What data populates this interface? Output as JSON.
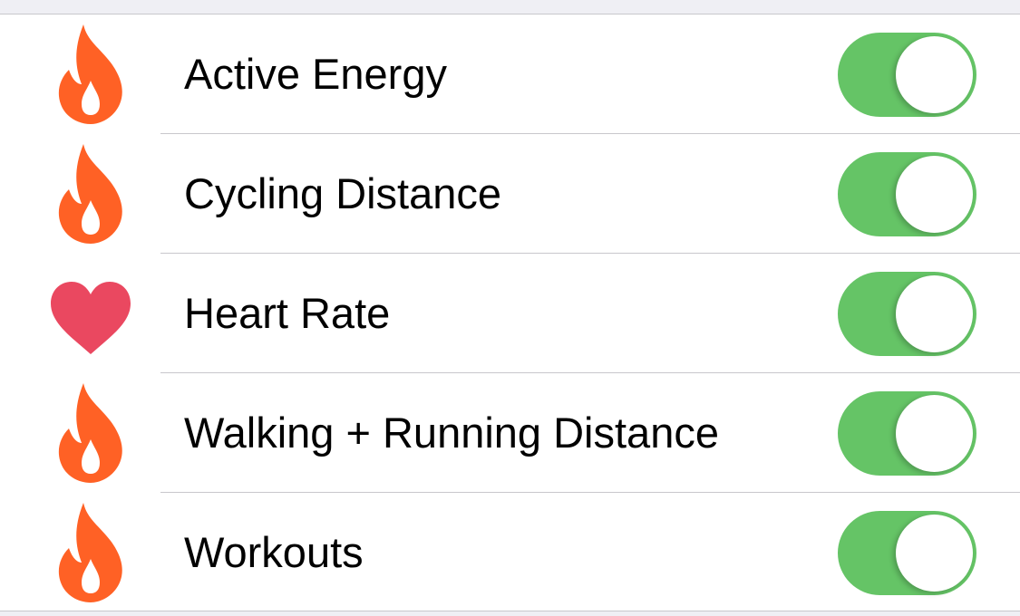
{
  "colors": {
    "flame": "#ff6125",
    "heart": "#ea4860",
    "toggle_on": "#65c466"
  },
  "items": [
    {
      "label": "Active Energy",
      "icon": "flame-icon",
      "on": true
    },
    {
      "label": "Cycling Distance",
      "icon": "flame-icon",
      "on": true
    },
    {
      "label": "Heart Rate",
      "icon": "heart-icon",
      "on": true
    },
    {
      "label": "Walking + Running Distance",
      "icon": "flame-icon",
      "on": true
    },
    {
      "label": "Workouts",
      "icon": "flame-icon",
      "on": true
    }
  ]
}
